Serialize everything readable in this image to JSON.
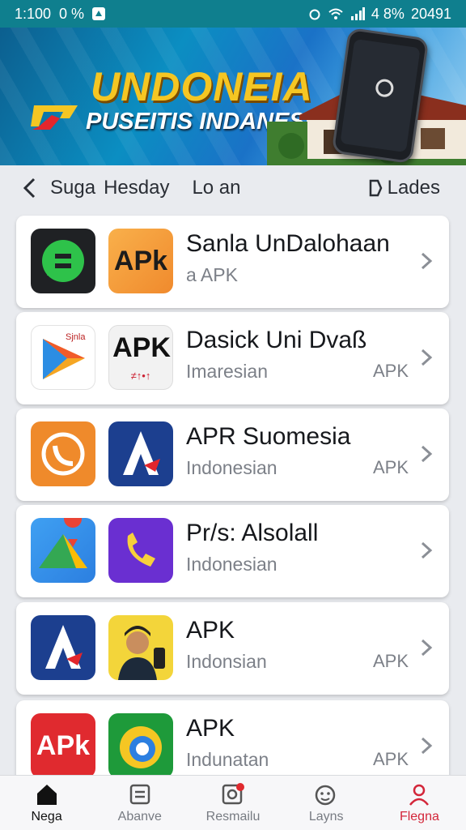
{
  "status_bar": {
    "time": "1:100",
    "left_extra": "0 %",
    "right_text": "4 8%",
    "clock": "20491"
  },
  "banner": {
    "title": "UNDONEIA",
    "subtitle": "PUSEITIS INDANESIA",
    "title_color": "#f5c623"
  },
  "nav": {
    "crumb1": "Suga",
    "crumb2": "Hesday",
    "crumb3": "Lo an",
    "right_label": "Lades"
  },
  "apps": [
    {
      "name": "Sanla UnDalohaan",
      "sub": "a APK",
      "tag": "",
      "icon1": "green-chat-icon",
      "icon2": "apk-orange-icon"
    },
    {
      "name": "Dasick Uni Dvaß",
      "sub": "Imaresian",
      "tag": "APK",
      "icon1": "play-store-icon",
      "icon2": "apk-file-icon"
    },
    {
      "name": "APR Suomesia",
      "sub": "Indonesian",
      "tag": "APK",
      "icon1": "orange-phone-icon",
      "icon2": "blue-a-icon"
    },
    {
      "name": "Pr/s: Alsolall",
      "sub": "Indonesian",
      "tag": "",
      "icon1": "maps-icon",
      "icon2": "purple-phone-icon"
    },
    {
      "name": "APK",
      "sub": "Indonsian",
      "tag": "APK",
      "icon1": "blue-a-icon",
      "icon2": "person-avatar-icon"
    },
    {
      "name": "APK",
      "sub": "Indunatan",
      "tag": "APK",
      "icon1": "apk-red-icon",
      "icon2": "colorful-circle-icon"
    }
  ],
  "icon_text": {
    "apk": "APk",
    "apk2": "APK",
    "apk_red": "APk",
    "small_mark": "Sjnla",
    "apk_code": "≠↑•↑"
  },
  "bottom_nav": [
    {
      "label": "Nega",
      "icon": "home-icon"
    },
    {
      "label": "Abanve",
      "icon": "inbox-icon"
    },
    {
      "label": "Resmailu",
      "icon": "search-badge-icon"
    },
    {
      "label": "Layns",
      "icon": "face-icon"
    },
    {
      "label": "Flegna",
      "icon": "profile-icon"
    }
  ],
  "colors": {
    "status_bar": "#0f7f8e",
    "accent_red": "#d3263a",
    "card_bg": "#ffffff",
    "page_bg": "#e9ebef"
  }
}
